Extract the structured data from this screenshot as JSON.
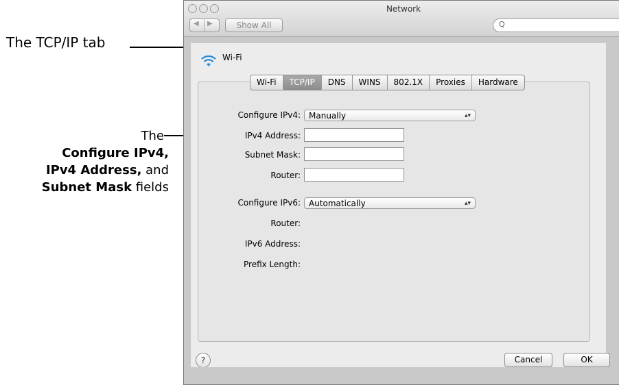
{
  "window": {
    "title": "Network",
    "show_all_label": "Show All",
    "search_placeholder": "Q",
    "nav_back": "◀",
    "nav_forward": "▶"
  },
  "annotations": {
    "tcpip_callout": "The TCP/IP tab",
    "fields_callout_line1": "The",
    "fields_callout_line2": "Configure IPv4,",
    "fields_callout_line3_bold": "IPv4 Address,",
    "fields_callout_line3_rest": " and",
    "fields_callout_line4_bold": "Subnet Mask",
    "fields_callout_line4_rest": " fields"
  },
  "interface": {
    "name": "Wi-Fi",
    "icon": "wifi-icon"
  },
  "tabs": [
    {
      "label": "Wi-Fi",
      "active": false
    },
    {
      "label": "TCP/IP",
      "active": true
    },
    {
      "label": "DNS",
      "active": false
    },
    {
      "label": "WINS",
      "active": false
    },
    {
      "label": "802.1X",
      "active": false
    },
    {
      "label": "Proxies",
      "active": false
    },
    {
      "label": "Hardware",
      "active": false
    }
  ],
  "form": {
    "configure_ipv4_label": "Configure IPv4:",
    "configure_ipv4_value": "Manually",
    "ipv4_address_label": "IPv4 Address:",
    "ipv4_address_value": "",
    "subnet_mask_label": "Subnet Mask:",
    "subnet_mask_value": "",
    "router_label": "Router:",
    "router_value": "",
    "configure_ipv6_label": "Configure IPv6:",
    "configure_ipv6_value": "Automatically",
    "router6_label": "Router:",
    "ipv6_address_label": "IPv6 Address:",
    "prefix_length_label": "Prefix Length:"
  },
  "buttons": {
    "help": "?",
    "cancel": "Cancel",
    "ok": "OK"
  },
  "colors": {
    "active_tab": "#8c8c8c",
    "wifi_icon": "#2a8bd6"
  }
}
